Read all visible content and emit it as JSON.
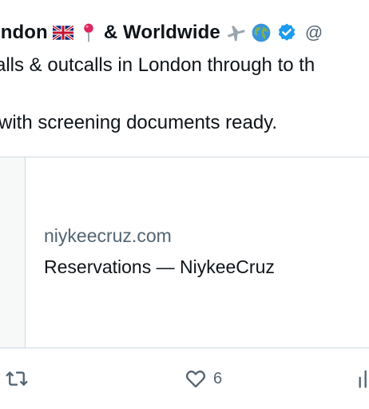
{
  "tweet": {
    "name_text": "ondon",
    "name_suffix": "& Worldwide",
    "handle_fragment": "@",
    "line1": "alls & outcalls in London through to th",
    "line2": "with screening documents ready."
  },
  "card": {
    "domain": "niykeecruz.com",
    "title": "Reservations — NiykeeCruz"
  },
  "actions": {
    "retweet_count": "",
    "like_count": "6"
  },
  "colors": {
    "text": "#0f1419",
    "muted": "#536471",
    "border": "#cfd9de",
    "verified": "#1d9bf0"
  },
  "icons": [
    "uk-flag-icon",
    "pin-icon",
    "airplane-icon",
    "globe-icon",
    "verified-badge-icon",
    "retweet-icon",
    "heart-icon",
    "views-icon"
  ]
}
